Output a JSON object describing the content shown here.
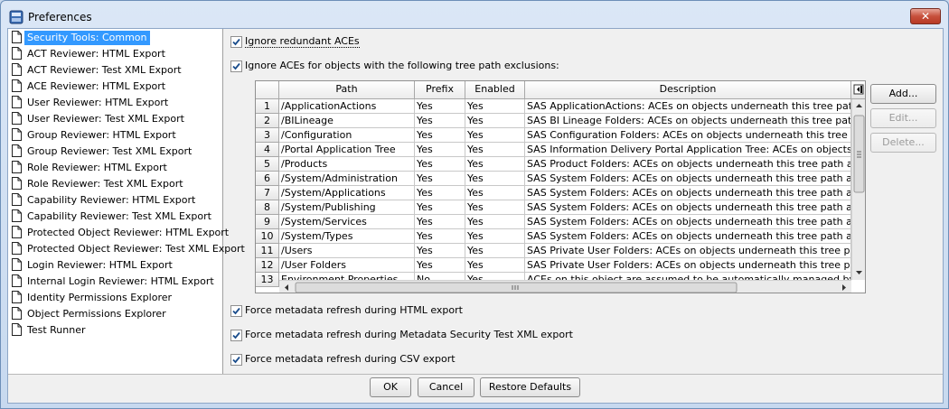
{
  "window": {
    "title": "Preferences",
    "close_label": "✕"
  },
  "sidebar": {
    "items": [
      {
        "label": "Security Tools: Common",
        "selected": true
      },
      {
        "label": "ACT Reviewer: HTML Export"
      },
      {
        "label": "ACT Reviewer: Test XML Export"
      },
      {
        "label": "ACE Reviewer: HTML Export"
      },
      {
        "label": "User Reviewer: HTML Export"
      },
      {
        "label": "User Reviewer: Test XML Export"
      },
      {
        "label": "Group Reviewer: HTML Export"
      },
      {
        "label": "Group Reviewer: Test XML Export"
      },
      {
        "label": "Role Reviewer: HTML Export"
      },
      {
        "label": "Role Reviewer: Test XML Export"
      },
      {
        "label": "Capability Reviewer: HTML Export"
      },
      {
        "label": "Capability Reviewer: Test XML Export"
      },
      {
        "label": "Protected Object Reviewer: HTML Export"
      },
      {
        "label": "Protected Object Reviewer: Test XML Export"
      },
      {
        "label": "Login Reviewer: HTML Export"
      },
      {
        "label": "Internal Login Reviewer: HTML Export"
      },
      {
        "label": "Identity Permissions Explorer"
      },
      {
        "label": "Object Permissions Explorer"
      },
      {
        "label": "Test Runner"
      }
    ]
  },
  "options": {
    "ignore_redundant": {
      "label": "Ignore redundant ACEs",
      "checked": true
    },
    "ignore_exclusions": {
      "label": "Ignore ACEs for objects with the following tree path exclusions:",
      "checked": true
    },
    "refresh_html": {
      "label": "Force metadata refresh during HTML export",
      "checked": true
    },
    "refresh_xml": {
      "label": "Force metadata refresh during Metadata Security Test XML export",
      "checked": true
    },
    "refresh_csv": {
      "label": "Force metadata refresh during CSV export",
      "checked": true
    }
  },
  "table": {
    "columns": [
      "Path",
      "Prefix",
      "Enabled",
      "Description"
    ],
    "rows": [
      {
        "num": "1",
        "path": "/ApplicationActions",
        "prefix": "Yes",
        "enabled": "Yes",
        "description": "SAS ApplicationActions: ACEs on objects underneath this tree path are ass"
      },
      {
        "num": "2",
        "path": "/BILineage",
        "prefix": "Yes",
        "enabled": "Yes",
        "description": "SAS BI Lineage Folders: ACEs on objects underneath this tree path are ass"
      },
      {
        "num": "3",
        "path": "/Configuration",
        "prefix": "Yes",
        "enabled": "Yes",
        "description": "SAS Configuration Folders: ACEs on objects underneath this tree path are a"
      },
      {
        "num": "4",
        "path": "/Portal Application Tree",
        "prefix": "Yes",
        "enabled": "Yes",
        "description": "SAS Information Delivery Portal Application Tree: ACEs on objects underne"
      },
      {
        "num": "5",
        "path": "/Products",
        "prefix": "Yes",
        "enabled": "Yes",
        "description": "SAS Product Folders: ACEs on objects underneath this tree path are assur"
      },
      {
        "num": "6",
        "path": "/System/Administration",
        "prefix": "Yes",
        "enabled": "Yes",
        "description": "SAS System Folders: ACEs on objects underneath this tree path are assum"
      },
      {
        "num": "7",
        "path": "/System/Applications",
        "prefix": "Yes",
        "enabled": "Yes",
        "description": "SAS System Folders: ACEs on objects underneath this tree path are assum"
      },
      {
        "num": "8",
        "path": "/System/Publishing",
        "prefix": "Yes",
        "enabled": "Yes",
        "description": "SAS System Folders: ACEs on objects underneath this tree path are assum"
      },
      {
        "num": "9",
        "path": "/System/Services",
        "prefix": "Yes",
        "enabled": "Yes",
        "description": "SAS System Folders: ACEs on objects underneath this tree path are assum"
      },
      {
        "num": "10",
        "path": "/System/Types",
        "prefix": "Yes",
        "enabled": "Yes",
        "description": "SAS System Folders: ACEs on objects underneath this tree path are assum"
      },
      {
        "num": "11",
        "path": "/Users",
        "prefix": "Yes",
        "enabled": "Yes",
        "description": "SAS Private User Folders: ACEs on objects underneath this tree path are a"
      },
      {
        "num": "12",
        "path": "/User Folders",
        "prefix": "Yes",
        "enabled": "Yes",
        "description": "SAS Private User Folders: ACEs on objects underneath this tree path are a"
      },
      {
        "num": "13",
        "path": "Environment Properties",
        "prefix": "No",
        "enabled": "Yes",
        "description": "ACEs on this object are assumed to be automatically managed by SAS soft"
      }
    ]
  },
  "table_buttons": {
    "add": "Add...",
    "edit": "Edit...",
    "delete": "Delete..."
  },
  "footer": {
    "ok": "OK",
    "cancel": "Cancel",
    "restore": "Restore Defaults"
  },
  "colors": {
    "selection": "#3399ff",
    "close": "#c7503c"
  }
}
